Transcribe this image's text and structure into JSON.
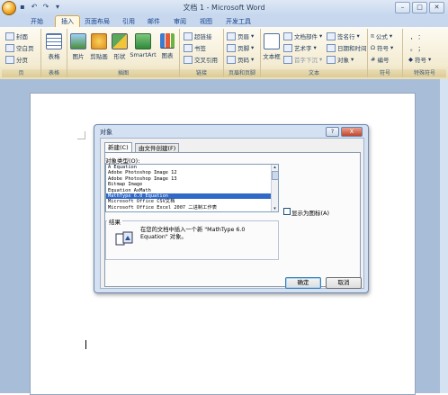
{
  "window": {
    "title": "文档 1 - Microsoft Word"
  },
  "tabs": [
    "开始",
    "插入",
    "页面布局",
    "引用",
    "邮件",
    "审阅",
    "视图",
    "开发工具"
  ],
  "ribbon": {
    "pages": {
      "label": "页",
      "cover": "封面",
      "blank": "空白页",
      "break": "分页"
    },
    "table": {
      "label": "表格",
      "btn": "表格"
    },
    "illustrations": {
      "label": "插图",
      "picture": "图片",
      "clipart": "剪贴画",
      "shapes": "形状",
      "smartart": "SmartArt",
      "chart": "图表"
    },
    "links": {
      "label": "链接",
      "hyperlink": "超链接",
      "bookmark": "书签",
      "crossref": "交叉引用"
    },
    "header_footer": {
      "label": "页眉和页脚",
      "header": "页眉",
      "footer": "页脚",
      "pagenum": "页码"
    },
    "text": {
      "label": "文本",
      "textbox": "文本框",
      "quickparts": "文档部件",
      "wordart": "艺术字",
      "dropcap": "首字下沉",
      "signature": "签名行",
      "datetime": "日期和时间",
      "object": "对象"
    },
    "symbols": {
      "label": "符号",
      "equation": "公式",
      "symbol": "符号",
      "number": "编号"
    },
    "special": {
      "label": "特殊符号",
      "symbol": "符号"
    }
  },
  "dialog": {
    "title": "对象",
    "help": "?",
    "close": "X",
    "tabs": [
      "新建(C)",
      "由文件创建(F)"
    ],
    "type_label": "对象类型(O):",
    "items": [
      "A Equation",
      "Adobe Photoshop Image 12",
      "Adobe Photoshop Image 13",
      "Bitmap Image",
      "Equation AxMath",
      "MathType 6.0 Equation",
      "Microsoft Office CSV文档",
      "Microsoft Office Excel 2007 二进制工作表"
    ],
    "selected_index": 5,
    "display_icon_label": "显示为图标(A)",
    "result_label": "结果",
    "result_text": "在您的文档中插入一个新 \"MathType 6.0 Equation\" 对象。",
    "ok": "确定",
    "cancel": "取消"
  }
}
